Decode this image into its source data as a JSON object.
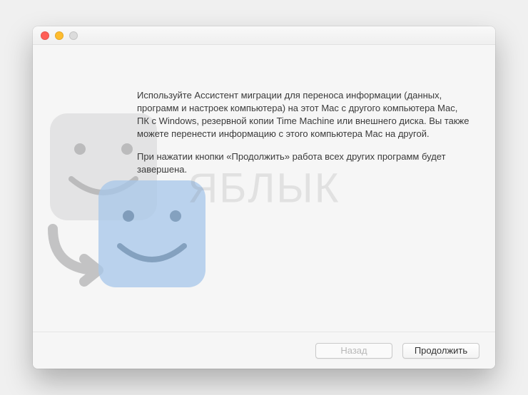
{
  "dialog": {
    "paragraph1": "Используйте Ассистент миграции для переноса информации (данных, программ и настроек компьютера) на этот Mac с другого компьютера Mac, ПК с Windows, резервной копии Time Machine или внешнего диска. Вы также можете перенести информацию с этого компьютера Mac на другой.",
    "paragraph2": "При нажатии кнопки «Продолжить» работа всех других программ будет завершена."
  },
  "buttons": {
    "back": "Назад",
    "continue": "Продолжить"
  },
  "watermark": "ЯБЛЫК"
}
